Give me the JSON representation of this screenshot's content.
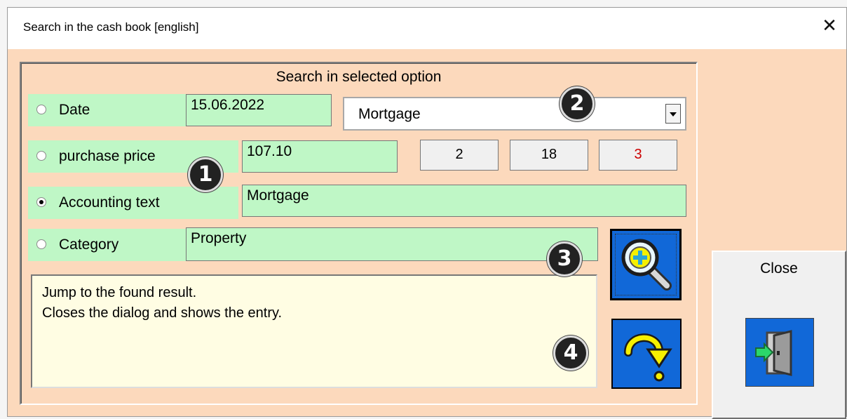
{
  "window": {
    "title": "Search in the cash book [english]"
  },
  "panel": {
    "title": "Search in selected option"
  },
  "options": {
    "date": {
      "label": "Date",
      "value": "15.06.2022",
      "selected": false
    },
    "price": {
      "label": "purchase price",
      "value": "107.10",
      "selected": false
    },
    "text": {
      "label": "Accounting text",
      "value": "Mortgage",
      "selected": true
    },
    "category": {
      "label": "Category",
      "value": "Property",
      "selected": false
    }
  },
  "combo": {
    "value": "Mortgage"
  },
  "counters": {
    "a": "2",
    "b": "18",
    "c": "3"
  },
  "colors": {
    "counter_c": "#cc0000",
    "field_bg": "#bff7c6",
    "window_bg": "#fcd9bc",
    "button_blue": "#1168d8"
  },
  "info": {
    "text": "Jump to the found result.\nCloses the dialog and shows the entry."
  },
  "badges": {
    "b1": "1",
    "b2": "2",
    "b3": "3",
    "b4": "4"
  },
  "close_button": {
    "label": "Close"
  },
  "icons": {
    "search": "search-plus-icon",
    "jump": "jump-arrow-icon",
    "exit": "exit-door-icon",
    "close": "close-icon"
  }
}
